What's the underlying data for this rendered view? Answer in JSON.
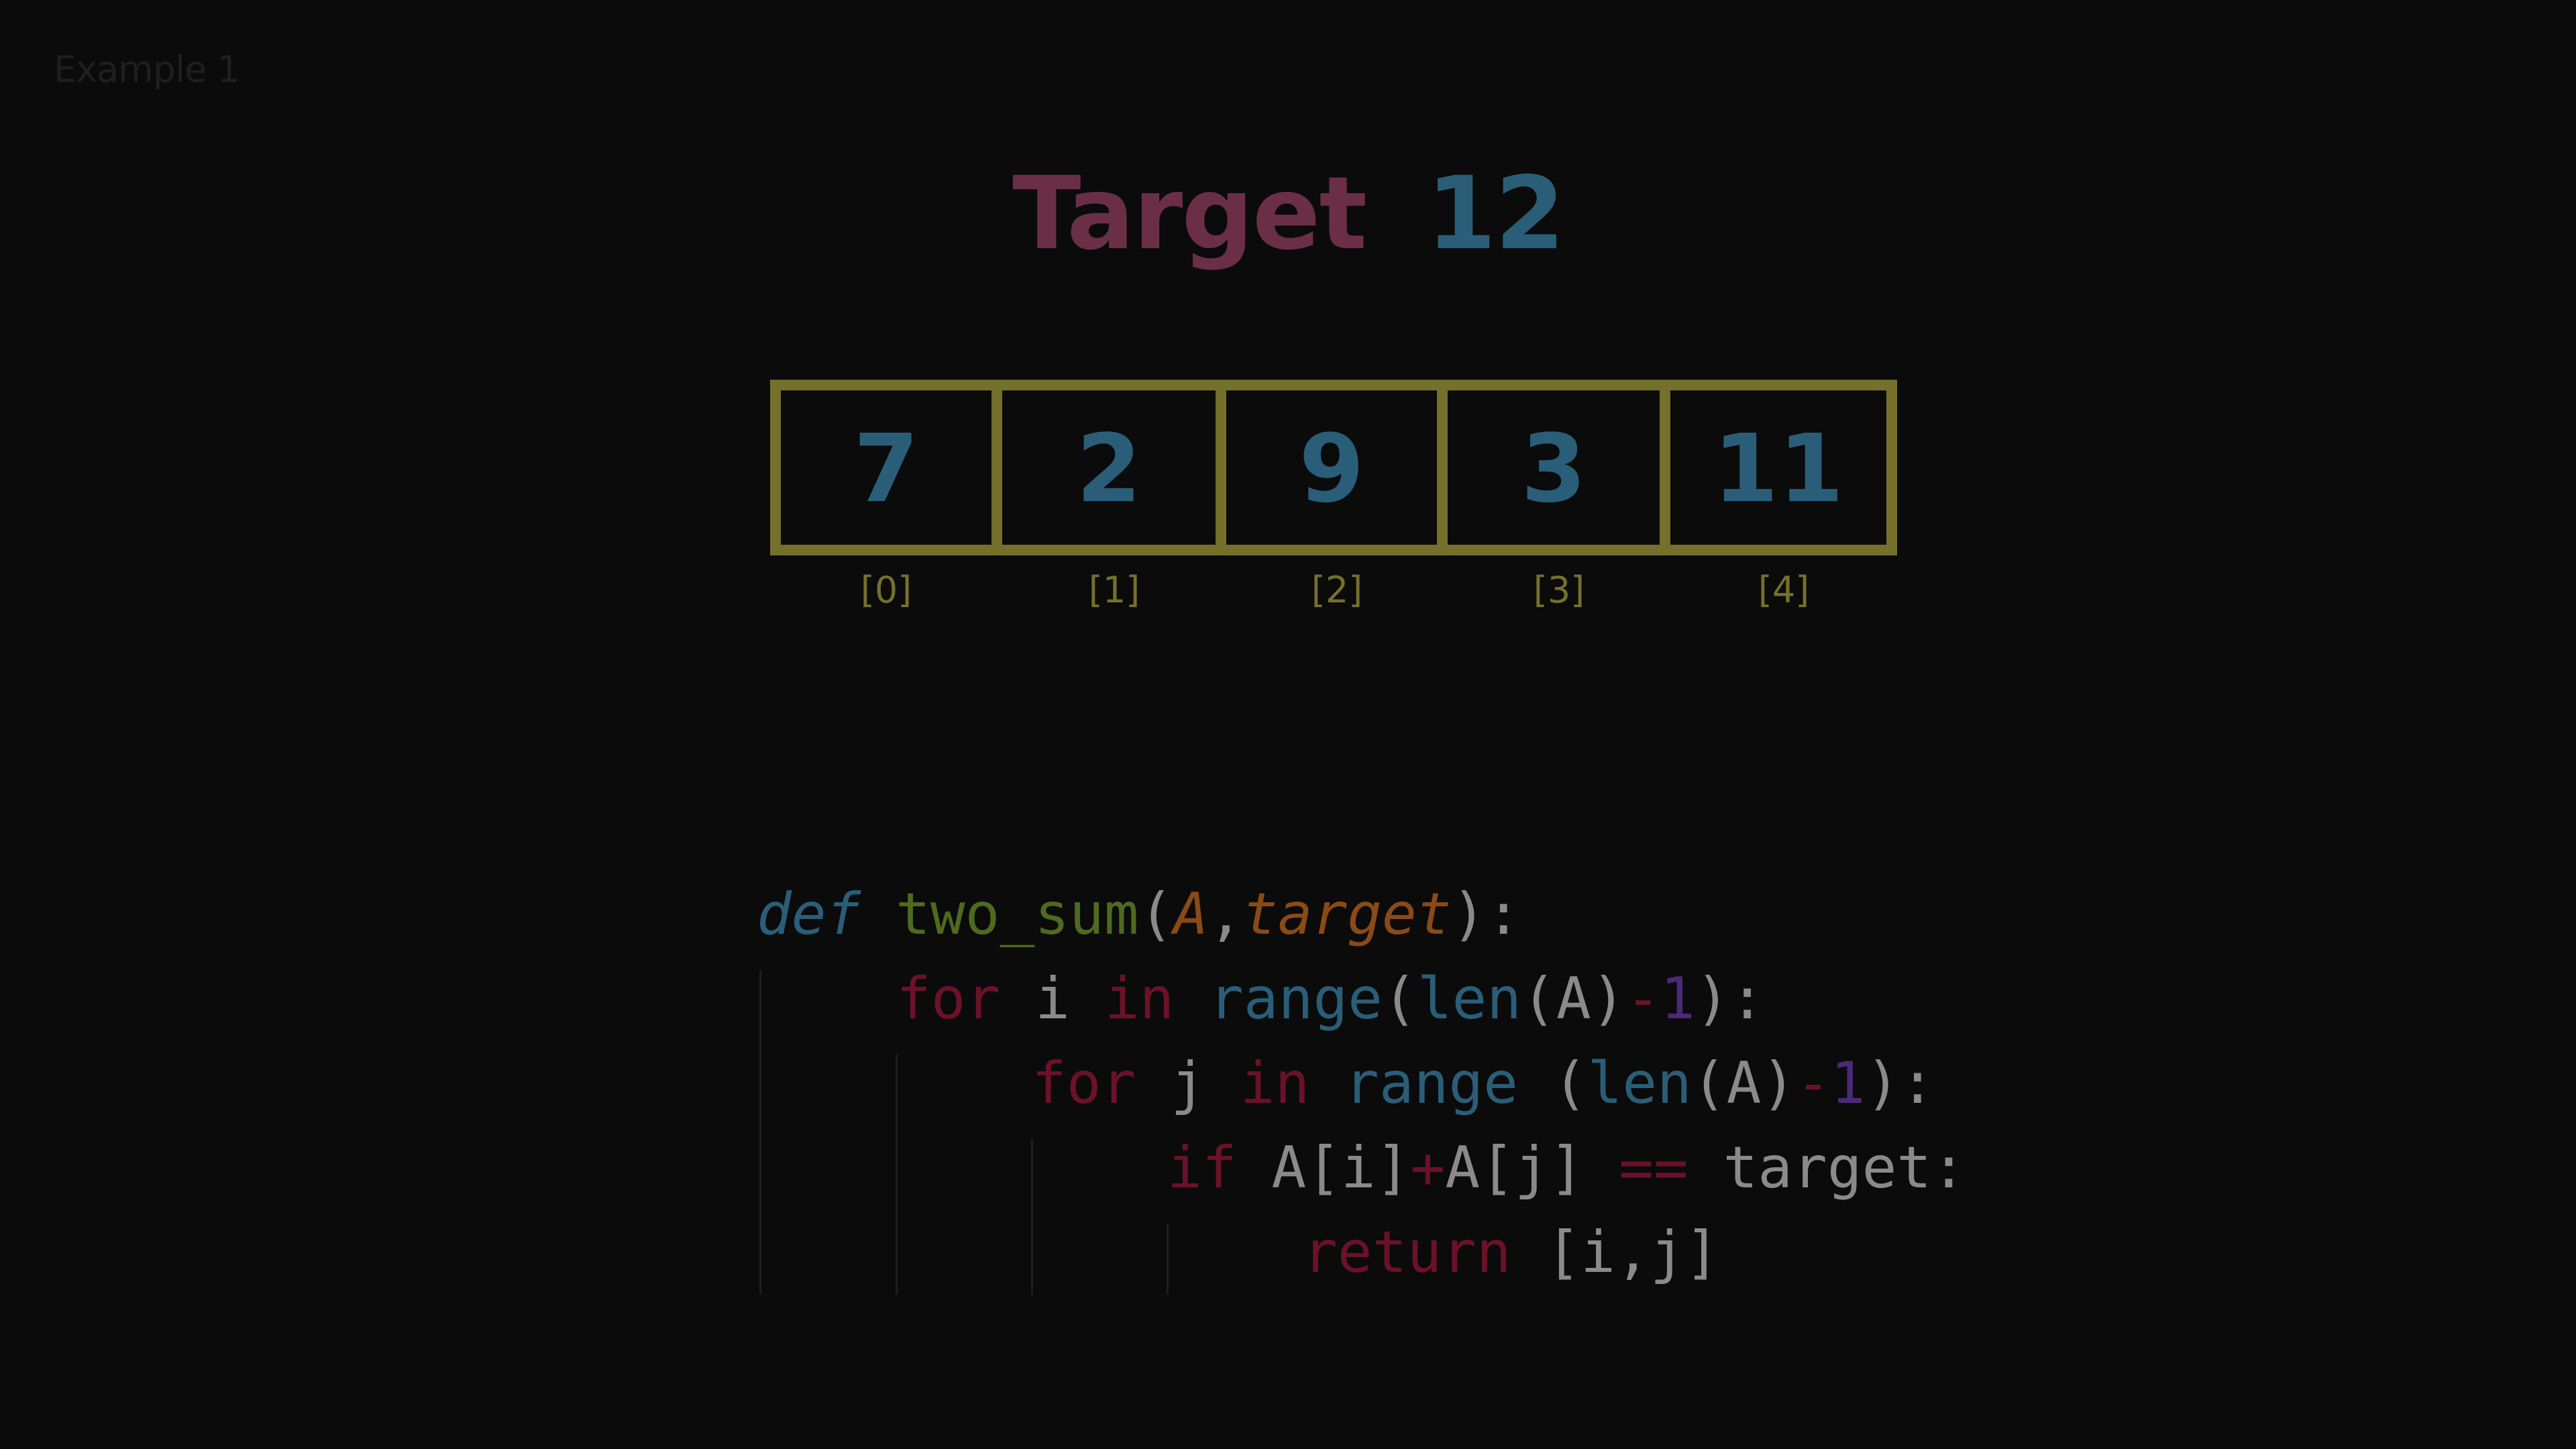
{
  "example_label": "Example 1",
  "title": {
    "word": "Target",
    "value": "12"
  },
  "array": {
    "values": [
      "7",
      "2",
      "9",
      "3",
      "11"
    ],
    "indices": [
      "[0]",
      "[1]",
      "[2]",
      "[3]",
      "[4]"
    ]
  },
  "code": {
    "lines": [
      [
        {
          "t": "def",
          "c": "kw-def"
        },
        {
          "t": " ",
          "c": "plain"
        },
        {
          "t": "two_sum",
          "c": "fn"
        },
        {
          "t": "(",
          "c": "plain"
        },
        {
          "t": "A",
          "c": "param"
        },
        {
          "t": ",",
          "c": "plain"
        },
        {
          "t": "target",
          "c": "param"
        },
        {
          "t": "):",
          "c": "plain"
        }
      ],
      [
        {
          "t": "for",
          "c": "kw"
        },
        {
          "t": " i ",
          "c": "plain"
        },
        {
          "t": "in",
          "c": "kw"
        },
        {
          "t": " ",
          "c": "plain"
        },
        {
          "t": "range",
          "c": "builtin"
        },
        {
          "t": "(",
          "c": "plain"
        },
        {
          "t": "len",
          "c": "builtin"
        },
        {
          "t": "(A)",
          "c": "plain"
        },
        {
          "t": "-",
          "c": "op"
        },
        {
          "t": "1",
          "c": "numlit"
        },
        {
          "t": "):",
          "c": "plain"
        }
      ],
      [
        {
          "t": "for",
          "c": "kw"
        },
        {
          "t": " j ",
          "c": "plain"
        },
        {
          "t": "in",
          "c": "kw"
        },
        {
          "t": " ",
          "c": "plain"
        },
        {
          "t": "range",
          "c": "builtin"
        },
        {
          "t": " (",
          "c": "plain"
        },
        {
          "t": "len",
          "c": "builtin"
        },
        {
          "t": "(A)",
          "c": "plain"
        },
        {
          "t": "-",
          "c": "op"
        },
        {
          "t": "1",
          "c": "numlit"
        },
        {
          "t": "):",
          "c": "plain"
        }
      ],
      [
        {
          "t": "if",
          "c": "kw"
        },
        {
          "t": " A[i]",
          "c": "plain"
        },
        {
          "t": "+",
          "c": "op"
        },
        {
          "t": "A[j] ",
          "c": "plain"
        },
        {
          "t": "==",
          "c": "op"
        },
        {
          "t": " target:",
          "c": "plain"
        }
      ],
      [
        {
          "t": "return",
          "c": "kw"
        },
        {
          "t": " [i,j]",
          "c": "plain"
        }
      ]
    ]
  },
  "colors": {
    "background": "#0b0b0b",
    "title_word": "#6b2f45",
    "title_value": "#2a5e78",
    "cell_border": "#75702c",
    "cell_value": "#2a5e78",
    "index": "#75702c"
  }
}
